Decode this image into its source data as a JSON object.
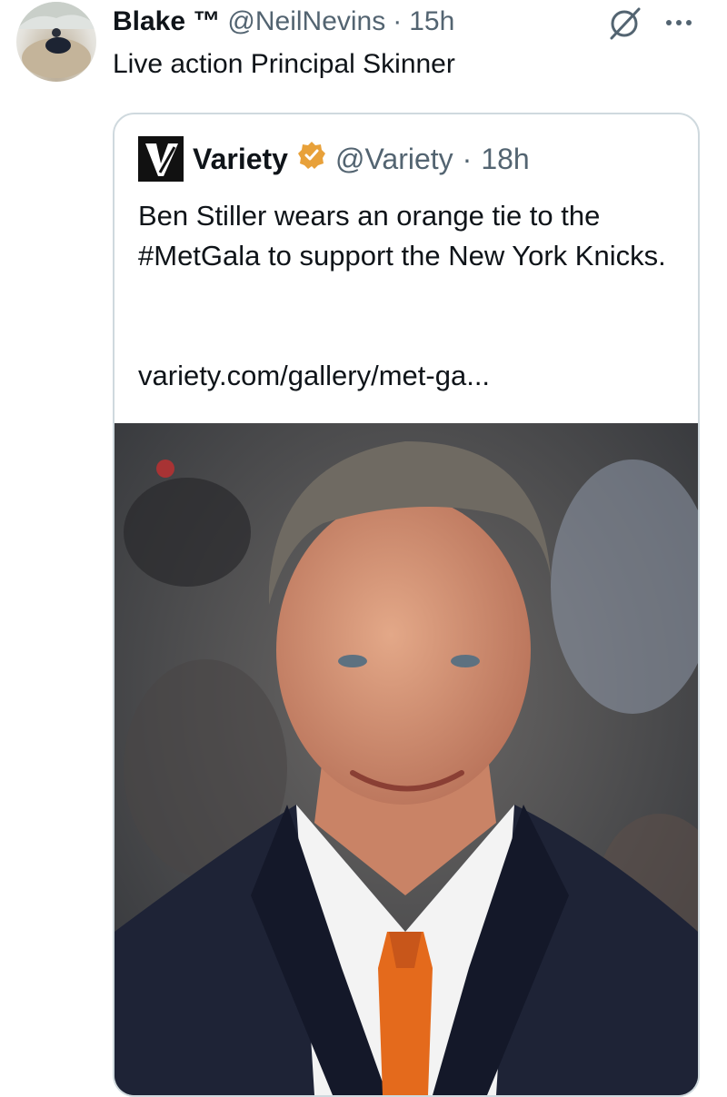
{
  "post": {
    "author_name": "Blake ™",
    "handle": "@NeilNevins",
    "separator": "·",
    "time": "15h",
    "text": "Live action Principal Skinner"
  },
  "icons": {
    "grok": "grok-icon",
    "more": "more-horizontal-icon",
    "verified": "verified-badge-icon",
    "brand_logo": "variety-logo-icon"
  },
  "quoted_post": {
    "author_name": "Variety",
    "logo_letter": "V",
    "handle": "@Variety",
    "separator": "·",
    "time": "18h",
    "text": "Ben Stiller wears an orange tie to the #MetGala to support the New York Knicks.",
    "link": "variety.com/gallery/met-ga...",
    "image_alt": "Ben Stiller at the Met Gala in a navy suit with an orange tie"
  },
  "colors": {
    "text_primary": "#0f1419",
    "text_secondary": "#536471",
    "border": "#cfd9de",
    "verified_gold": "#e8a13a",
    "tie_orange": "#e46a1c"
  }
}
